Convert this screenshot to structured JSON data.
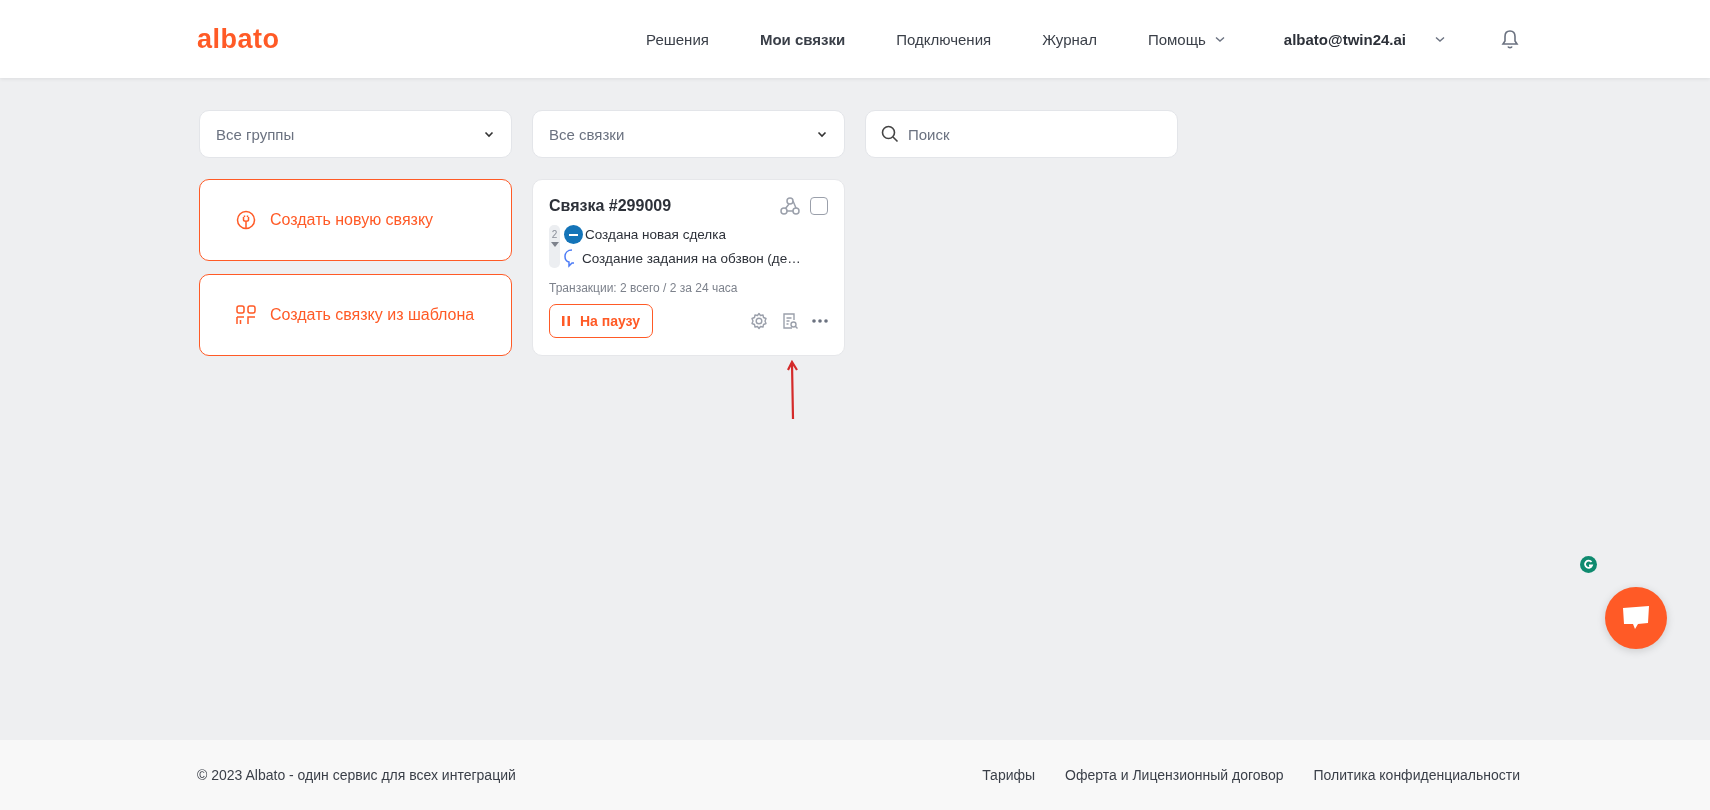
{
  "header": {
    "logo": "albato",
    "nav": [
      {
        "label": "Решения",
        "selected": false,
        "dropdown": false
      },
      {
        "label": "Мои связки",
        "selected": true,
        "dropdown": false
      },
      {
        "label": "Подключения",
        "selected": false,
        "dropdown": false
      },
      {
        "label": "Журнал",
        "selected": false,
        "dropdown": false
      },
      {
        "label": "Помощь",
        "selected": false,
        "dropdown": true
      }
    ],
    "account": "albato@twin24.ai"
  },
  "filters": [
    {
      "kind": "select",
      "value": "Все группы"
    },
    {
      "kind": "select",
      "value": "Все связки"
    },
    {
      "kind": "search",
      "placeholder": "Поиск"
    }
  ],
  "actions": [
    {
      "kind": "new",
      "label": "Создать новую связку"
    },
    {
      "kind": "template",
      "label": "Создать связку из шаблона"
    }
  ],
  "card": {
    "title": "Связка #299009",
    "checked": false,
    "step_count": "2",
    "steps": [
      {
        "kind": "amo",
        "label": "Создана новая сделка"
      },
      {
        "kind": "chat",
        "label": "Создание задания на обзвон (де…"
      }
    ],
    "transactions": "Транзакции: 2 всего / 2 за 24 часа",
    "pause_button": "На паузу"
  },
  "footer": {
    "copyright": "© 2023 Albato - один сервис для всех интеграций",
    "links": [
      "Тарифы",
      "Оферта и Лицензионный договор",
      "Политика конфиденциальности"
    ]
  }
}
